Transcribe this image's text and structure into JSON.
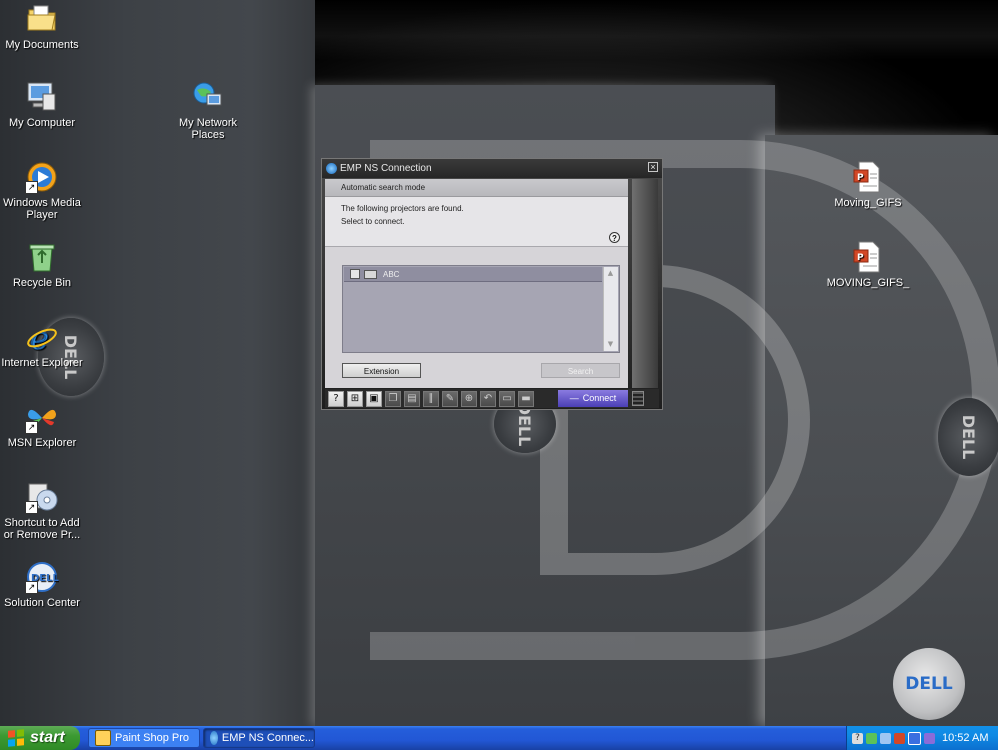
{
  "desktop": {
    "icons": [
      {
        "label": "My Documents"
      },
      {
        "label": "My Computer"
      },
      {
        "label": "My Network Places"
      },
      {
        "label": "Windows Media Player"
      },
      {
        "label": "Recycle Bin"
      },
      {
        "label": "Internet Explorer"
      },
      {
        "label": "MSN Explorer"
      },
      {
        "label": "Shortcut to Add or Remove Pr..."
      },
      {
        "label": "Solution Center"
      },
      {
        "label": "Moving_GIFS"
      },
      {
        "label": "MOVING_GIFS_"
      }
    ],
    "wallpaper_logo": "DELL"
  },
  "dialog": {
    "title": "EMP NS Connection",
    "close_glyph": "×",
    "mode_label": "Automatic search mode",
    "info_line1": "The following projectors are found.",
    "info_line2": "Select to connect.",
    "help_glyph": "?",
    "list": {
      "items": [
        {
          "name": "ABC",
          "checked": false
        }
      ]
    },
    "buttons": {
      "extension": "Extension",
      "search": "Search",
      "connect": "Connect"
    }
  },
  "taskbar": {
    "start_label": "start",
    "tasks": [
      {
        "label": "Paint Shop Pro"
      },
      {
        "label": "EMP NS Connec..."
      }
    ],
    "clock": "10:52 AM"
  },
  "colors": {
    "taskbar_blue": "#245edb",
    "start_green": "#3c9a32",
    "connect_purple": "#4b3fb5"
  }
}
